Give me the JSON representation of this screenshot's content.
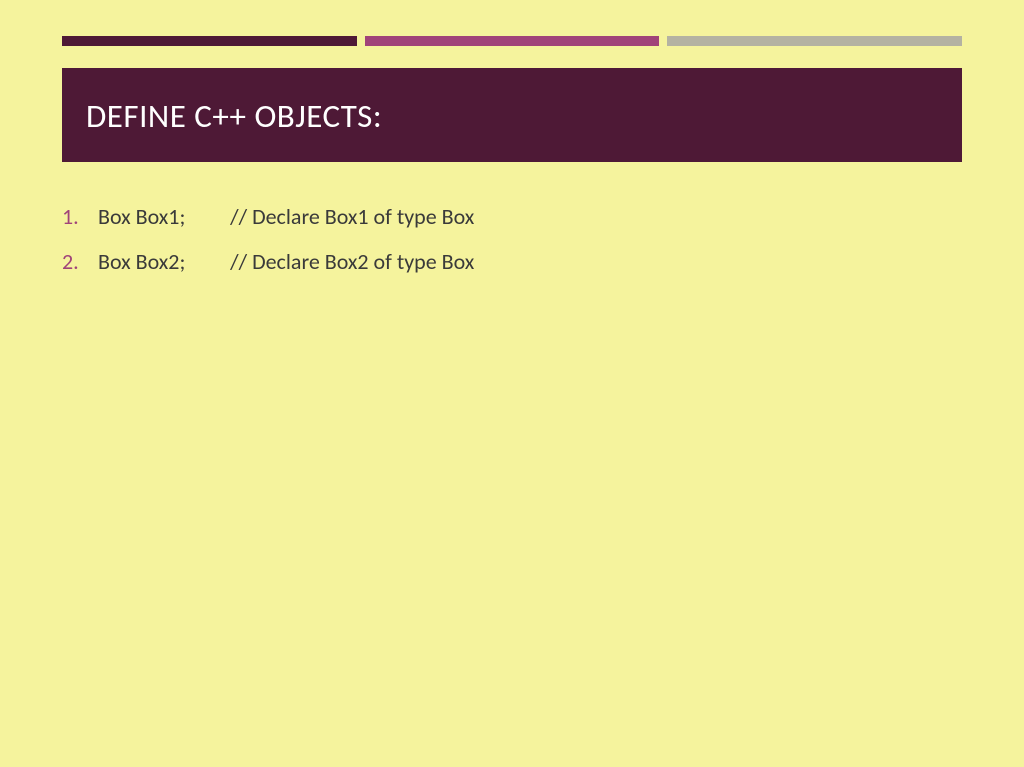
{
  "slide": {
    "title": "DEFINE C++ OBJECTS:",
    "items": [
      {
        "number": "1.",
        "text": "Box Box1;         // Declare Box1 of type Box"
      },
      {
        "number": "2.",
        "text": "Box Box2;         // Declare Box2 of type Box"
      }
    ]
  },
  "colors": {
    "background": "#f5f39d",
    "titleBg": "#4e1936",
    "titleText": "#ffffff",
    "accentBar1": "#4e1936",
    "accentBar2": "#a04379",
    "accentBar3": "#b4b2a2",
    "listNumber": "#a04379",
    "listText": "#3a3a3a"
  }
}
